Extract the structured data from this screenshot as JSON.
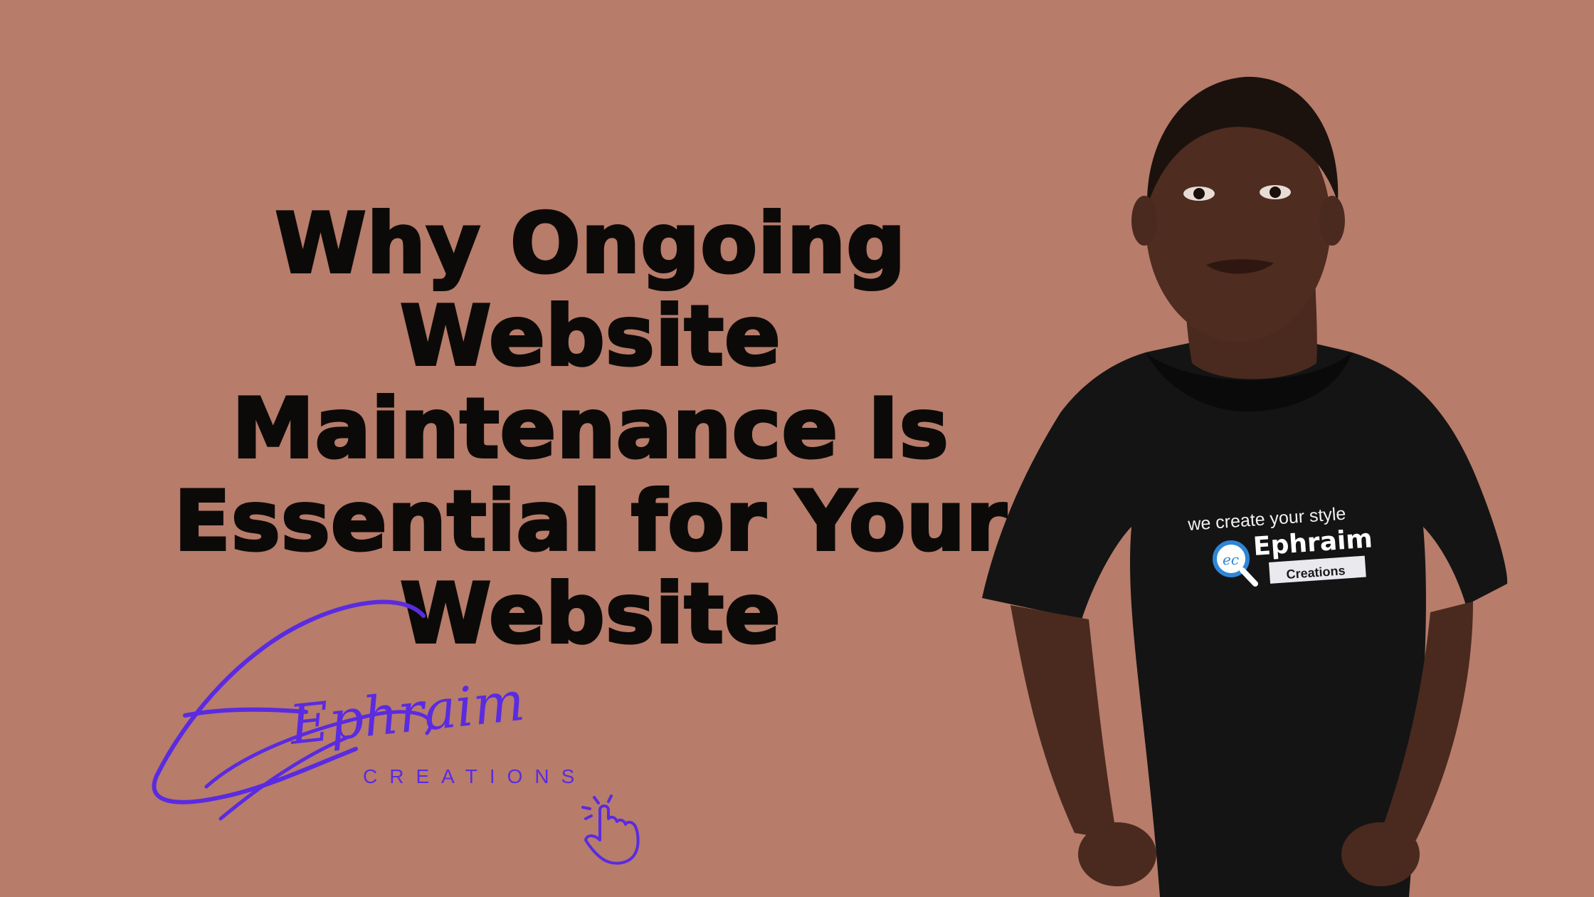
{
  "headline": {
    "line1": "Why Ongoing Website",
    "line2": "Maintenance Is",
    "line3": "Essential for Your",
    "line4": "Website"
  },
  "logo": {
    "script_text": "Ephraim",
    "subtitle": "CREATIONS",
    "accent_color": "#5a2be0"
  },
  "person": {
    "shirt_tagline": "we create your style",
    "shirt_brand": "Ephraim",
    "shirt_badge": "Creations",
    "shirt_monogram": "ec"
  },
  "colors": {
    "background": "#b77c6a",
    "headline": "#0c0a09",
    "shirt": "#141414"
  }
}
